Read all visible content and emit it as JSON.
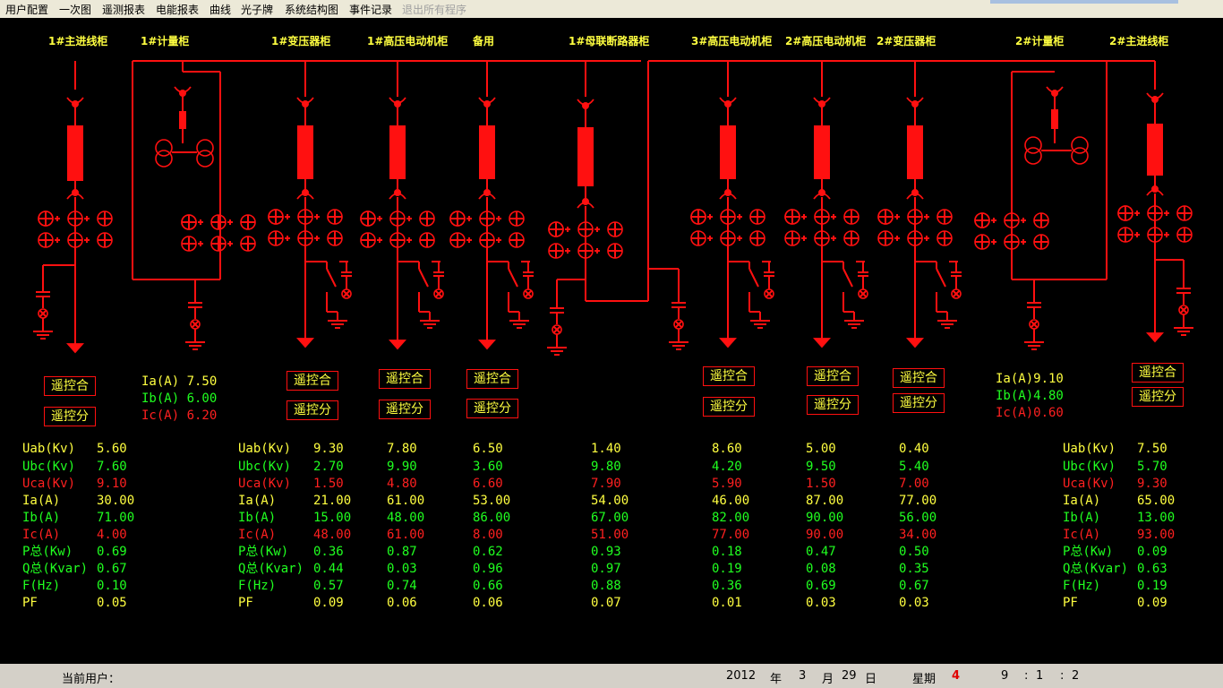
{
  "menu": {
    "items": [
      "用户配置",
      "一次图",
      "遥测报表",
      "电能报表",
      "曲线",
      "光子牌",
      "系统结构图",
      "事件记录"
    ],
    "exit_label": "退出所有程序"
  },
  "cabinets": [
    "1#主进线柜",
    "1#计量柜",
    "1#变压器柜",
    "1#高压电动机柜",
    "备用",
    "1#母联断路器柜",
    "3#高压电动机柜",
    "2#高压电动机柜",
    "2#变压器柜",
    "2#计量柜",
    "2#主进线柜"
  ],
  "remote": {
    "close": "遥控合",
    "open": "遥控分"
  },
  "meter1": {
    "ia": "Ia(A) 7.50",
    "ib": "Ib(A) 6.00",
    "ic": "Ic(A) 6.20"
  },
  "meter2": {
    "ia": "Ia(A)9.10",
    "ib": "Ib(A)4.80",
    "ic": "Ic(A)0.60"
  },
  "labels": [
    "Uab(Kv)",
    "Ubc(Kv)",
    "Uca(Kv)",
    "Ia(A)",
    "Ib(A)",
    "Ic(A)",
    "P总(Kw)",
    "Q总(Kvar)",
    "F(Hz)",
    "PF"
  ],
  "columns": [
    [
      "5.60",
      "7.60",
      "9.10",
      "30.00",
      "71.00",
      "4.00",
      "0.69",
      "0.67",
      "0.10",
      "0.05"
    ],
    [
      "9.30",
      "2.70",
      "1.50",
      "21.00",
      "15.00",
      "48.00",
      "0.36",
      "0.44",
      "0.57",
      "0.09"
    ],
    [
      "7.80",
      "9.90",
      "4.80",
      "61.00",
      "48.00",
      "61.00",
      "0.87",
      "0.03",
      "0.74",
      "0.06"
    ],
    [
      "6.50",
      "3.60",
      "6.60",
      "53.00",
      "86.00",
      "8.00",
      "0.62",
      "0.96",
      "0.66",
      "0.06"
    ],
    [
      "1.40",
      "9.80",
      "7.90",
      "54.00",
      "67.00",
      "51.00",
      "0.93",
      "0.97",
      "0.88",
      "0.07"
    ],
    [
      "8.60",
      "4.20",
      "5.90",
      "46.00",
      "82.00",
      "77.00",
      "0.18",
      "0.19",
      "0.36",
      "0.01"
    ],
    [
      "5.00",
      "9.50",
      "1.50",
      "87.00",
      "90.00",
      "90.00",
      "0.47",
      "0.08",
      "0.69",
      "0.03"
    ],
    [
      "0.40",
      "5.40",
      "7.00",
      "77.00",
      "56.00",
      "34.00",
      "0.50",
      "0.35",
      "0.67",
      "0.03"
    ],
    [
      "7.50",
      "5.70",
      "9.30",
      "65.00",
      "13.00",
      "93.00",
      "0.09",
      "0.63",
      "0.19",
      "0.09"
    ]
  ],
  "status": {
    "user_label": "当前用户：",
    "year": "2012",
    "year_unit": "年",
    "month": "3",
    "month_unit": "月",
    "day": "29",
    "day_unit": "日",
    "week_label": "星期",
    "weekday": "4",
    "hour": "9",
    "sep1": ":",
    "minute": "1",
    "sep2": ":",
    "second": "2"
  },
  "colors": {
    "line": "#ff1010",
    "title": "#ffff40",
    "green": "#20ff20",
    "red": "#ff2020",
    "bg": "#000000"
  }
}
